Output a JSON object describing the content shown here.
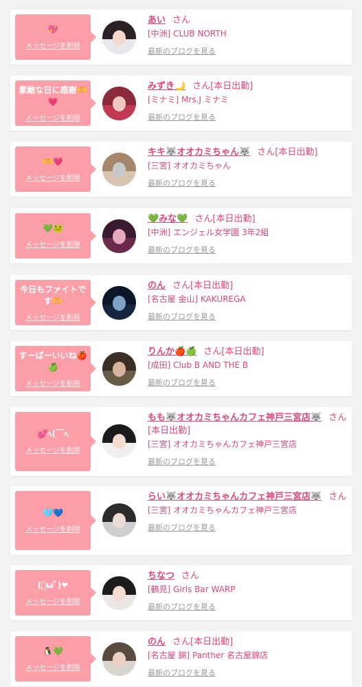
{
  "delete_label": "メッセージを削除",
  "blog_label": "最新のブログを見る",
  "san_label": "さん",
  "colors": {
    "bubble": "#fb9ea8",
    "accent": "#e0457a",
    "muted": "#999999"
  },
  "items": [
    {
      "message": "💖",
      "name": "あい",
      "status": "",
      "shop": "[中洲] CLUB NORTH"
    },
    {
      "message": "素敵な日に感謝🫶💗",
      "name": "みずき🌙",
      "status": "[本日出勤]",
      "shop": "[ミナミ] Mrs.J ミナミ"
    },
    {
      "message": "🫶💗",
      "name": "キキ🐺オオカミちゃん🐺",
      "status": "[本日出勤]",
      "shop": "[三宮] オオカミちゃん"
    },
    {
      "message": "💚🐸",
      "name": "💚みな💚",
      "status": "[本日出勤]",
      "shop": "[中洲] エンジェル女学園 3年2組"
    },
    {
      "message": "今日もファイトです🫶",
      "name": "のん",
      "status": "[本日出勤]",
      "shop": "[名古屋 金山] KAKUREGA"
    },
    {
      "message": "すーぱーいいね🍎🍏",
      "name": "りんか🍎🍏",
      "status": "[本日出勤]",
      "shop": "[成田] Club B AND THE B"
    },
    {
      "message": "💕ﾍ(￣ﾍ",
      "name": "もも🐺オオカミちゃんカフェ神戸三宮店🐺",
      "status": "[本日出勤]",
      "shop": "[三宮] オオカミちゃんカフェ神戸三宮店"
    },
    {
      "message": "🩵💙",
      "name": "らい🐺オオカミちゃんカフェ神戸三宮店🐺",
      "status": "",
      "shop": "[三宮] オオカミちゃんカフェ神戸三宮店"
    },
    {
      "message": "(ﾟωﾟ)❤",
      "name": "ちなつ",
      "status": "",
      "shop": "[鶴見] Girls Bar WARP"
    },
    {
      "message": "🐧💚",
      "name": "のん",
      "status": "[本日出勤]",
      "shop": "[名古屋 錦] Panther 名古屋錦店"
    }
  ]
}
